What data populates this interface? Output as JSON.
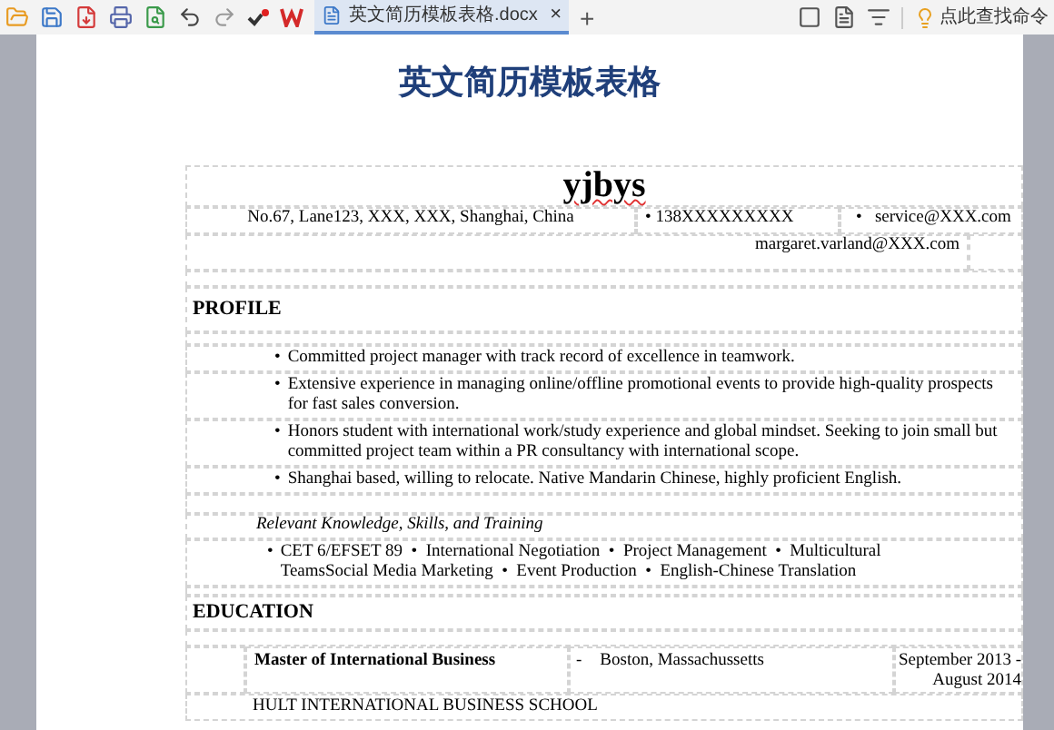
{
  "toolbar": {
    "tabs": [
      {
        "label": "英文简历模板表格.docx",
        "selected": true,
        "close": "×"
      }
    ],
    "new_tab": "+",
    "command_search": "点此查找命令"
  },
  "document": {
    "title": "英文简历模板表格",
    "name": {
      "text": "yjbys",
      "misspelled": true
    },
    "contact": {
      "address": "No.67, Lane123, XXX, XXX, Shanghai, China",
      "phone": "138XXXXXXXXX",
      "email": "service@XXX.com",
      "email_2": "margaret.varland@XXX.com"
    },
    "bullet": "•",
    "profile": {
      "heading": "PROFILE",
      "items": [
        "Committed project manager with track record of excellence in teamwork.",
        "Extensive experience in managing online/offline promotional events to provide high-quality prospects for fast sales conversion.",
        "Honors student with international work/study experience and global mindset. Seeking to join small but committed project team within a PR consultancy with international scope.",
        "Shanghai based, willing to relocate. Native Mandarin Chinese, highly proficient English."
      ]
    },
    "skills": {
      "heading": "Relevant Knowledge, Skills, and Training",
      "text": "CET 6/EFSET 89  •  International Negotiation  •  Project Management  •  Multicultural TeamsSocial Media Marketing  •  Event Production  •  English-Chinese Translation"
    },
    "education": {
      "heading": "EDUCATION",
      "degree": "Master of International Business",
      "dash": "-",
      "location": "Boston, Massachussetts",
      "dates": "September 2013 - August 2014",
      "school": "HULT INTERNATIONAL BUSINESS SCHOOL"
    }
  }
}
